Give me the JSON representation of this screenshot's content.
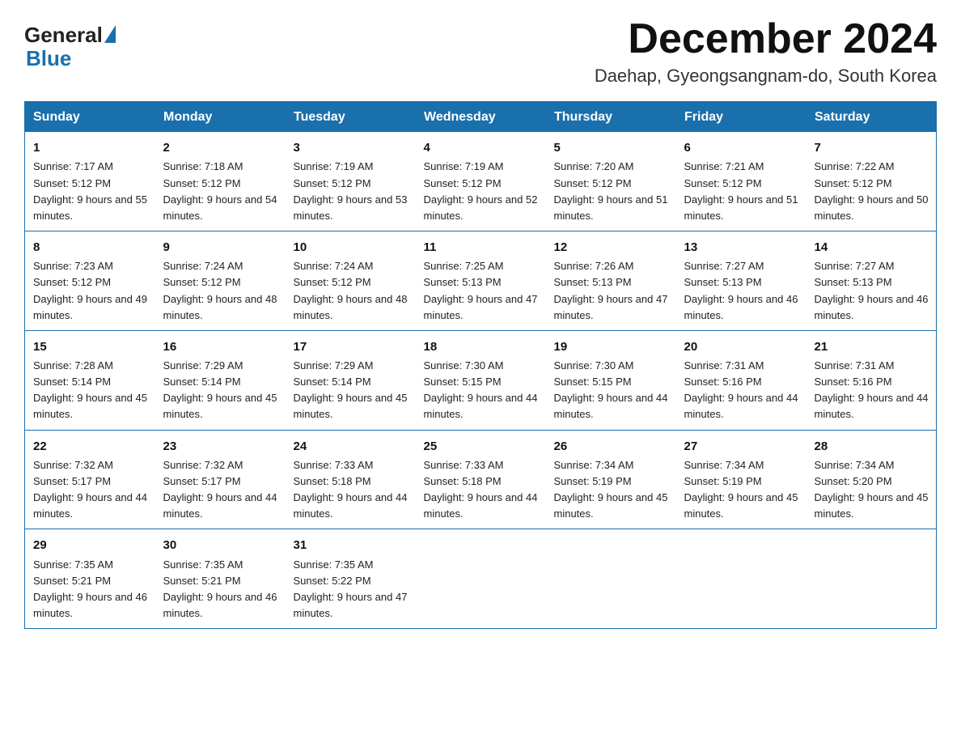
{
  "header": {
    "logo_general": "General",
    "logo_blue": "Blue",
    "month_title": "December 2024",
    "location": "Daehap, Gyeongsangnam-do, South Korea"
  },
  "weekdays": [
    "Sunday",
    "Monday",
    "Tuesday",
    "Wednesday",
    "Thursday",
    "Friday",
    "Saturday"
  ],
  "weeks": [
    [
      {
        "day": "1",
        "sunrise": "7:17 AM",
        "sunset": "5:12 PM",
        "daylight": "9 hours and 55 minutes."
      },
      {
        "day": "2",
        "sunrise": "7:18 AM",
        "sunset": "5:12 PM",
        "daylight": "9 hours and 54 minutes."
      },
      {
        "day": "3",
        "sunrise": "7:19 AM",
        "sunset": "5:12 PM",
        "daylight": "9 hours and 53 minutes."
      },
      {
        "day": "4",
        "sunrise": "7:19 AM",
        "sunset": "5:12 PM",
        "daylight": "9 hours and 52 minutes."
      },
      {
        "day": "5",
        "sunrise": "7:20 AM",
        "sunset": "5:12 PM",
        "daylight": "9 hours and 51 minutes."
      },
      {
        "day": "6",
        "sunrise": "7:21 AM",
        "sunset": "5:12 PM",
        "daylight": "9 hours and 51 minutes."
      },
      {
        "day": "7",
        "sunrise": "7:22 AM",
        "sunset": "5:12 PM",
        "daylight": "9 hours and 50 minutes."
      }
    ],
    [
      {
        "day": "8",
        "sunrise": "7:23 AM",
        "sunset": "5:12 PM",
        "daylight": "9 hours and 49 minutes."
      },
      {
        "day": "9",
        "sunrise": "7:24 AM",
        "sunset": "5:12 PM",
        "daylight": "9 hours and 48 minutes."
      },
      {
        "day": "10",
        "sunrise": "7:24 AM",
        "sunset": "5:12 PM",
        "daylight": "9 hours and 48 minutes."
      },
      {
        "day": "11",
        "sunrise": "7:25 AM",
        "sunset": "5:13 PM",
        "daylight": "9 hours and 47 minutes."
      },
      {
        "day": "12",
        "sunrise": "7:26 AM",
        "sunset": "5:13 PM",
        "daylight": "9 hours and 47 minutes."
      },
      {
        "day": "13",
        "sunrise": "7:27 AM",
        "sunset": "5:13 PM",
        "daylight": "9 hours and 46 minutes."
      },
      {
        "day": "14",
        "sunrise": "7:27 AM",
        "sunset": "5:13 PM",
        "daylight": "9 hours and 46 minutes."
      }
    ],
    [
      {
        "day": "15",
        "sunrise": "7:28 AM",
        "sunset": "5:14 PM",
        "daylight": "9 hours and 45 minutes."
      },
      {
        "day": "16",
        "sunrise": "7:29 AM",
        "sunset": "5:14 PM",
        "daylight": "9 hours and 45 minutes."
      },
      {
        "day": "17",
        "sunrise": "7:29 AM",
        "sunset": "5:14 PM",
        "daylight": "9 hours and 45 minutes."
      },
      {
        "day": "18",
        "sunrise": "7:30 AM",
        "sunset": "5:15 PM",
        "daylight": "9 hours and 44 minutes."
      },
      {
        "day": "19",
        "sunrise": "7:30 AM",
        "sunset": "5:15 PM",
        "daylight": "9 hours and 44 minutes."
      },
      {
        "day": "20",
        "sunrise": "7:31 AM",
        "sunset": "5:16 PM",
        "daylight": "9 hours and 44 minutes."
      },
      {
        "day": "21",
        "sunrise": "7:31 AM",
        "sunset": "5:16 PM",
        "daylight": "9 hours and 44 minutes."
      }
    ],
    [
      {
        "day": "22",
        "sunrise": "7:32 AM",
        "sunset": "5:17 PM",
        "daylight": "9 hours and 44 minutes."
      },
      {
        "day": "23",
        "sunrise": "7:32 AM",
        "sunset": "5:17 PM",
        "daylight": "9 hours and 44 minutes."
      },
      {
        "day": "24",
        "sunrise": "7:33 AM",
        "sunset": "5:18 PM",
        "daylight": "9 hours and 44 minutes."
      },
      {
        "day": "25",
        "sunrise": "7:33 AM",
        "sunset": "5:18 PM",
        "daylight": "9 hours and 44 minutes."
      },
      {
        "day": "26",
        "sunrise": "7:34 AM",
        "sunset": "5:19 PM",
        "daylight": "9 hours and 45 minutes."
      },
      {
        "day": "27",
        "sunrise": "7:34 AM",
        "sunset": "5:19 PM",
        "daylight": "9 hours and 45 minutes."
      },
      {
        "day": "28",
        "sunrise": "7:34 AM",
        "sunset": "5:20 PM",
        "daylight": "9 hours and 45 minutes."
      }
    ],
    [
      {
        "day": "29",
        "sunrise": "7:35 AM",
        "sunset": "5:21 PM",
        "daylight": "9 hours and 46 minutes."
      },
      {
        "day": "30",
        "sunrise": "7:35 AM",
        "sunset": "5:21 PM",
        "daylight": "9 hours and 46 minutes."
      },
      {
        "day": "31",
        "sunrise": "7:35 AM",
        "sunset": "5:22 PM",
        "daylight": "9 hours and 47 minutes."
      },
      null,
      null,
      null,
      null
    ]
  ],
  "labels": {
    "sunrise_prefix": "Sunrise: ",
    "sunset_prefix": "Sunset: ",
    "daylight_prefix": "Daylight: "
  }
}
